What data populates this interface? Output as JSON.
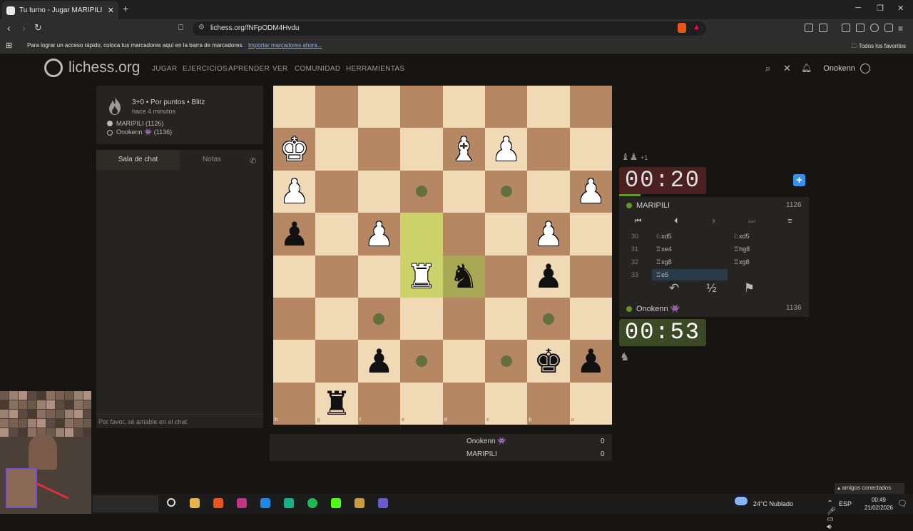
{
  "browser": {
    "tab_title": "Tu turno - Jugar MARIPILI • l…",
    "url": "lichess.org/fNFpODM4Hvdu",
    "bookmark_message": "Para lograr un acceso rápido, coloca tus marcadores aquí en la barra de marcadores.",
    "bookmark_link": "Importar marcadores ahora...",
    "all_bookmarks": "Todos los favoritos"
  },
  "site": {
    "name": "lichess.org",
    "menu": [
      "JUGAR",
      "EJERCICIOS",
      "APRENDER",
      "VER",
      "COMUNIDAD",
      "HERRAMIENTAS"
    ],
    "username": "Onokenn"
  },
  "game": {
    "mode": "3+0 • Por puntos • Blitz",
    "started": "hace 4 minutos",
    "white_player": "MARIPILI (1126)",
    "black_player": "Onokenn 👾 (1136)"
  },
  "chat": {
    "tab_chat": "Sala de chat",
    "tab_notes": "Notas",
    "placeholder": "Por favor, sé amable en el chat"
  },
  "board": {
    "files_bottom": [
      "h",
      "g",
      "f",
      "e",
      "d",
      "c",
      "b",
      "a"
    ],
    "ranks_right": [
      "1",
      "2",
      "3",
      "4",
      "5",
      "6",
      "7",
      "8"
    ]
  },
  "score": {
    "p1_name": "Onokenn 👾",
    "p1_score": "0",
    "p2_name": "MARIPILI",
    "p2_score": "0"
  },
  "right_panel": {
    "captured": "+1",
    "clock_top": "00:20",
    "clock_bottom": "00:53",
    "top_player": "MARIPILI",
    "top_rating": "1126",
    "bottom_player": "Onokenn 👾",
    "bottom_rating": "1136",
    "moves": [
      {
        "n": "30",
        "w": "♘xd5",
        "b": "♘xd5"
      },
      {
        "n": "31",
        "w": "♖xe4",
        "b": "♖hg8"
      },
      {
        "n": "32",
        "w": "♖xg8",
        "b": "♖xg8"
      },
      {
        "n": "33",
        "w": "♖e5",
        "b": ""
      }
    ]
  },
  "taskbar": {
    "weather": "24°C  Nublado",
    "lang": "ESP",
    "time": "00:49",
    "date": "21/02/2026",
    "notif_count": "6",
    "friends": "amigos conectados"
  },
  "colors": {
    "light_square": "#f0d9b5",
    "dark_square": "#b58863",
    "highlight": "#cdd26a",
    "clock_low": "#4a2020",
    "clock_active": "#3b4a25",
    "online_green": "#629924"
  }
}
